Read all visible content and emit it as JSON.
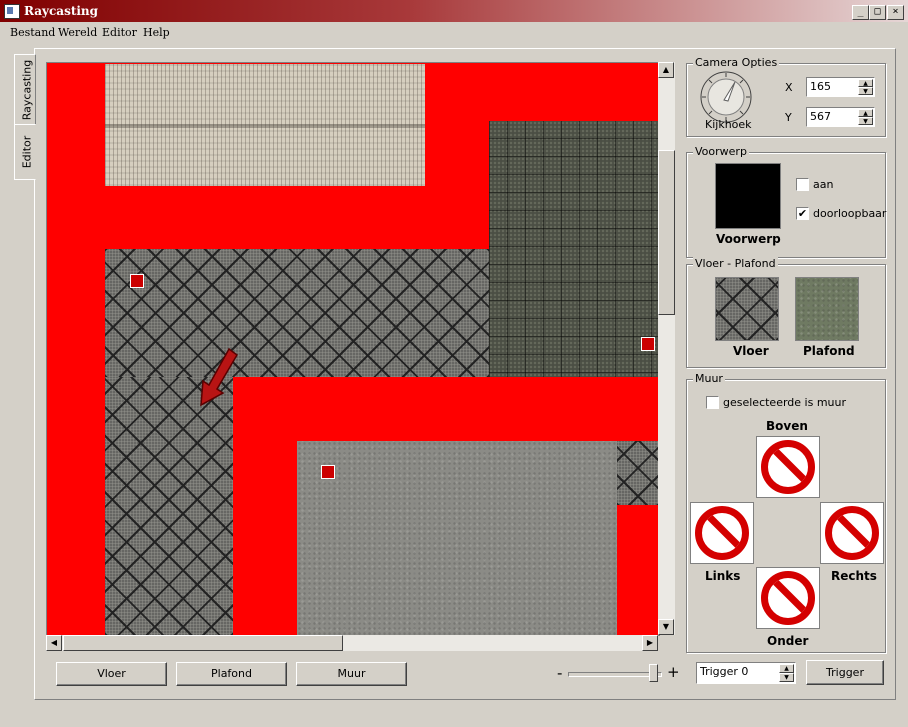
{
  "window": {
    "title": "Raycasting",
    "btn_min": "_",
    "btn_max": "□",
    "btn_close": "×"
  },
  "menu": [
    "Bestand",
    "Wereld",
    "Editor",
    "Help"
  ],
  "side_tabs": [
    "Raycasting",
    "Editor"
  ],
  "camera": {
    "group_label": "Camera Opties",
    "dial_label": "Kijkhoek",
    "x_label": "X",
    "x_value": "165",
    "y_label": "Y",
    "y_value": "567"
  },
  "object": {
    "group_label": "Voorwerp",
    "preview_label": "Voorwerp",
    "aan_label": "aan",
    "aan_checked": false,
    "walk_label": "doorloopbaar",
    "walk_checked": true
  },
  "floor": {
    "group_label": "Vloer - Plafond",
    "floor_label": "Vloer",
    "ceiling_label": "Plafond"
  },
  "wall": {
    "group_label": "Muur",
    "is_wall_label": "geselecteerde is muur",
    "is_wall_checked": false,
    "top_label": "Boven",
    "left_label": "Links",
    "right_label": "Rechts",
    "bottom_label": "Onder"
  },
  "bottom": {
    "btn_floor": "Vloer",
    "btn_ceiling": "Plafond",
    "btn_wall": "Muur",
    "zoom_minus": "-",
    "zoom_plus": "+",
    "trigger_value": "Trigger 0",
    "trigger_button": "Trigger"
  },
  "colors": {
    "wall_red": "#ff0000",
    "marker": "#cc0000",
    "titlebar": "#800000"
  }
}
